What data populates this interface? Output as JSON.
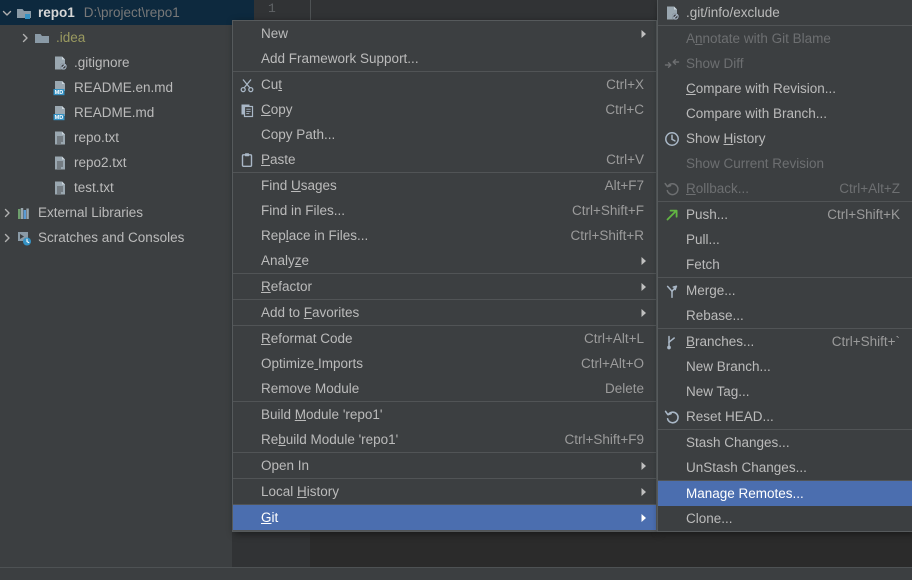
{
  "project_tree": {
    "rows": [
      {
        "indent": 0,
        "arrow": "chevron-down",
        "icon": "module-folder-icon",
        "label": "repo1",
        "bold": true,
        "sub": "D:\\project\\repo1",
        "selected": true
      },
      {
        "indent": 1,
        "arrow": "chevron-right",
        "icon": "folder-icon",
        "label": ".idea",
        "bold": false,
        "sub": "",
        "selected": false,
        "label_color": "#9a9a60"
      },
      {
        "indent": 2,
        "arrow": "none",
        "icon": "gitignore-file-icon",
        "label": ".gitignore",
        "bold": false,
        "sub": "",
        "selected": false
      },
      {
        "indent": 2,
        "arrow": "none",
        "icon": "markdown-file-icon",
        "label": "README.en.md",
        "bold": false,
        "sub": "",
        "selected": false
      },
      {
        "indent": 2,
        "arrow": "none",
        "icon": "markdown-file-icon",
        "label": "README.md",
        "bold": false,
        "sub": "",
        "selected": false
      },
      {
        "indent": 2,
        "arrow": "none",
        "icon": "text-file-icon",
        "label": "repo.txt",
        "bold": false,
        "sub": "",
        "selected": false
      },
      {
        "indent": 2,
        "arrow": "none",
        "icon": "text-file-icon",
        "label": "repo2.txt",
        "bold": false,
        "sub": "",
        "selected": false
      },
      {
        "indent": 2,
        "arrow": "none",
        "icon": "text-file-icon",
        "label": "test.txt",
        "bold": false,
        "sub": "",
        "selected": false
      },
      {
        "indent": 0,
        "arrow": "chevron-right",
        "icon": "external-libraries-icon",
        "label": "External Libraries",
        "bold": false,
        "sub": "",
        "selected": false
      },
      {
        "indent": 0,
        "arrow": "chevron-right",
        "icon": "scratches-icon",
        "label": "Scratches and Consoles",
        "bold": false,
        "sub": "",
        "selected": false
      }
    ]
  },
  "editor": {
    "line_number": "1"
  },
  "status_bar": {
    "text": ""
  },
  "context_menu": {
    "items": [
      {
        "type": "item",
        "label": "New",
        "accel": "",
        "icon": "",
        "submenu": true,
        "disabled": false,
        "highlight": false,
        "mnemonic": -1
      },
      {
        "type": "item",
        "label": "Add Framework Support...",
        "accel": "",
        "icon": "",
        "submenu": false,
        "disabled": false,
        "highlight": false,
        "mnemonic": -1
      },
      {
        "type": "sep"
      },
      {
        "type": "item",
        "label": "Cut",
        "accel": "Ctrl+X",
        "icon": "cut-icon",
        "submenu": false,
        "disabled": false,
        "highlight": false,
        "mnemonic": 2
      },
      {
        "type": "item",
        "label": "Copy",
        "accel": "Ctrl+C",
        "icon": "copy-icon",
        "submenu": false,
        "disabled": false,
        "highlight": false,
        "mnemonic": 0
      },
      {
        "type": "item",
        "label": "Copy Path...",
        "accel": "",
        "icon": "",
        "submenu": false,
        "disabled": false,
        "highlight": false,
        "mnemonic": -1
      },
      {
        "type": "item",
        "label": "Paste",
        "accel": "Ctrl+V",
        "icon": "paste-icon",
        "submenu": false,
        "disabled": false,
        "highlight": false,
        "mnemonic": 0
      },
      {
        "type": "sep"
      },
      {
        "type": "item",
        "label": "Find Usages",
        "accel": "Alt+F7",
        "icon": "",
        "submenu": false,
        "disabled": false,
        "highlight": false,
        "mnemonic": 5
      },
      {
        "type": "item",
        "label": "Find in Files...",
        "accel": "Ctrl+Shift+F",
        "icon": "",
        "submenu": false,
        "disabled": false,
        "highlight": false,
        "mnemonic": -1
      },
      {
        "type": "item",
        "label": "Replace in Files...",
        "accel": "Ctrl+Shift+R",
        "icon": "",
        "submenu": false,
        "disabled": false,
        "highlight": false,
        "mnemonic": 3
      },
      {
        "type": "item",
        "label": "Analyze",
        "accel": "",
        "icon": "",
        "submenu": true,
        "disabled": false,
        "highlight": false,
        "mnemonic": 5
      },
      {
        "type": "sep"
      },
      {
        "type": "item",
        "label": "Refactor",
        "accel": "",
        "icon": "",
        "submenu": true,
        "disabled": false,
        "highlight": false,
        "mnemonic": 0
      },
      {
        "type": "sep"
      },
      {
        "type": "item",
        "label": "Add to Favorites",
        "accel": "",
        "icon": "",
        "submenu": true,
        "disabled": false,
        "highlight": false,
        "mnemonic": 7
      },
      {
        "type": "sep"
      },
      {
        "type": "item",
        "label": "Reformat Code",
        "accel": "Ctrl+Alt+L",
        "icon": "",
        "submenu": false,
        "disabled": false,
        "highlight": false,
        "mnemonic": 0
      },
      {
        "type": "item",
        "label": "Optimize Imports",
        "accel": "Ctrl+Alt+O",
        "icon": "",
        "submenu": false,
        "disabled": false,
        "highlight": false,
        "mnemonic": 8
      },
      {
        "type": "item",
        "label": "Remove Module",
        "accel": "Delete",
        "icon": "",
        "submenu": false,
        "disabled": false,
        "highlight": false,
        "mnemonic": -1
      },
      {
        "type": "sep"
      },
      {
        "type": "item",
        "label": "Build Module 'repo1'",
        "accel": "",
        "icon": "",
        "submenu": false,
        "disabled": false,
        "highlight": false,
        "mnemonic": 6
      },
      {
        "type": "item",
        "label": "Rebuild Module 'repo1'",
        "accel": "Ctrl+Shift+F9",
        "icon": "",
        "submenu": false,
        "disabled": false,
        "highlight": false,
        "mnemonic": 2
      },
      {
        "type": "sep"
      },
      {
        "type": "item",
        "label": "Open In",
        "accel": "",
        "icon": "",
        "submenu": true,
        "disabled": false,
        "highlight": false,
        "mnemonic": -1
      },
      {
        "type": "sep"
      },
      {
        "type": "item",
        "label": "Local History",
        "accel": "",
        "icon": "",
        "submenu": true,
        "disabled": false,
        "highlight": false,
        "mnemonic": 6
      },
      {
        "type": "sep"
      },
      {
        "type": "item",
        "label": "Git",
        "accel": "",
        "icon": "",
        "submenu": true,
        "disabled": false,
        "highlight": true,
        "mnemonic": 0
      },
      {
        "type": "sep"
      }
    ]
  },
  "git_submenu": {
    "items": [
      {
        "type": "item",
        "label": ".git/info/exclude",
        "accel": "",
        "icon": "gitignore-file-icon",
        "submenu": false,
        "disabled": false,
        "highlight": false,
        "mnemonic": -1
      },
      {
        "type": "sep"
      },
      {
        "type": "item",
        "label": "Annotate with Git Blame",
        "accel": "",
        "icon": "",
        "submenu": false,
        "disabled": true,
        "highlight": false,
        "mnemonic": 1
      },
      {
        "type": "item",
        "label": "Show Diff",
        "accel": "",
        "icon": "show-diff-icon",
        "submenu": false,
        "disabled": true,
        "highlight": false,
        "mnemonic": -1
      },
      {
        "type": "item",
        "label": "Compare with Revision...",
        "accel": "",
        "icon": "",
        "submenu": false,
        "disabled": false,
        "highlight": false,
        "mnemonic": 0
      },
      {
        "type": "item",
        "label": "Compare with Branch...",
        "accel": "",
        "icon": "",
        "submenu": false,
        "disabled": false,
        "highlight": false,
        "mnemonic": -1
      },
      {
        "type": "item",
        "label": "Show History",
        "accel": "",
        "icon": "history-clock-icon",
        "submenu": false,
        "disabled": false,
        "highlight": false,
        "mnemonic": 5
      },
      {
        "type": "item",
        "label": "Show Current Revision",
        "accel": "",
        "icon": "",
        "submenu": false,
        "disabled": true,
        "highlight": false,
        "mnemonic": -1
      },
      {
        "type": "item",
        "label": "Rollback...",
        "accel": "Ctrl+Alt+Z",
        "icon": "rollback-icon",
        "submenu": false,
        "disabled": true,
        "highlight": false,
        "mnemonic": 0
      },
      {
        "type": "sep"
      },
      {
        "type": "item",
        "label": "Push...",
        "accel": "Ctrl+Shift+K",
        "icon": "push-icon",
        "submenu": false,
        "disabled": false,
        "highlight": false,
        "mnemonic": -1
      },
      {
        "type": "item",
        "label": "Pull...",
        "accel": "",
        "icon": "",
        "submenu": false,
        "disabled": false,
        "highlight": false,
        "mnemonic": -1
      },
      {
        "type": "item",
        "label": "Fetch",
        "accel": "",
        "icon": "",
        "submenu": false,
        "disabled": false,
        "highlight": false,
        "mnemonic": -1
      },
      {
        "type": "sep"
      },
      {
        "type": "item",
        "label": "Merge...",
        "accel": "",
        "icon": "merge-icon",
        "submenu": false,
        "disabled": false,
        "highlight": false,
        "mnemonic": -1
      },
      {
        "type": "item",
        "label": "Rebase...",
        "accel": "",
        "icon": "",
        "submenu": false,
        "disabled": false,
        "highlight": false,
        "mnemonic": -1
      },
      {
        "type": "sep"
      },
      {
        "type": "item",
        "label": "Branches...",
        "accel": "Ctrl+Shift+`",
        "icon": "branch-icon",
        "submenu": false,
        "disabled": false,
        "highlight": false,
        "mnemonic": 0
      },
      {
        "type": "item",
        "label": "New Branch...",
        "accel": "",
        "icon": "",
        "submenu": false,
        "disabled": false,
        "highlight": false,
        "mnemonic": -1
      },
      {
        "type": "item",
        "label": "New Tag...",
        "accel": "",
        "icon": "",
        "submenu": false,
        "disabled": false,
        "highlight": false,
        "mnemonic": -1
      },
      {
        "type": "item",
        "label": "Reset HEAD...",
        "accel": "",
        "icon": "reset-head-icon",
        "submenu": false,
        "disabled": false,
        "highlight": false,
        "mnemonic": -1
      },
      {
        "type": "sep"
      },
      {
        "type": "item",
        "label": "Stash Changes...",
        "accel": "",
        "icon": "",
        "submenu": false,
        "disabled": false,
        "highlight": false,
        "mnemonic": -1
      },
      {
        "type": "item",
        "label": "UnStash Changes...",
        "accel": "",
        "icon": "",
        "submenu": false,
        "disabled": false,
        "highlight": false,
        "mnemonic": -1
      },
      {
        "type": "sep"
      },
      {
        "type": "item",
        "label": "Manage Remotes...",
        "accel": "",
        "icon": "",
        "submenu": false,
        "disabled": false,
        "highlight": true,
        "mnemonic": -1
      },
      {
        "type": "item",
        "label": "Clone...",
        "accel": "",
        "icon": "",
        "submenu": false,
        "disabled": false,
        "highlight": false,
        "mnemonic": -1
      }
    ]
  },
  "colors": {
    "menu_bg": "#3c3f41",
    "menu_border": "#565a5c",
    "separator": "#515456",
    "highlight_blue": "#4b6eaf",
    "tree_selected": "#0d293e",
    "text": "#bbbbbb",
    "text_disabled": "#6d6f71",
    "accel_text": "#9b9b9b",
    "editor_bg": "#2b2b2b",
    "gutter_bg": "#313335",
    "md_badge": "#3592c4",
    "push_arrow_green": "#62b543"
  }
}
